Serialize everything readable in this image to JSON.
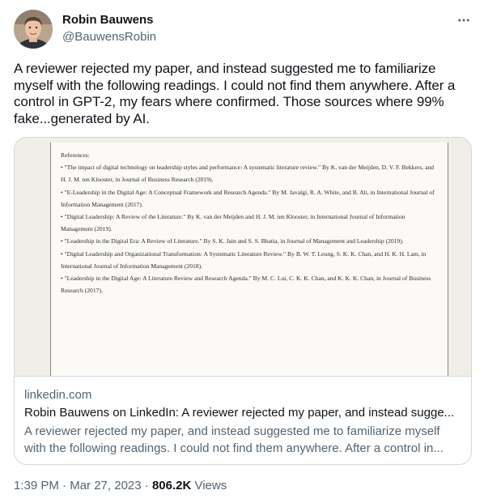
{
  "author": {
    "name": "Robin Bauwens",
    "handle": "@BauwensRobin"
  },
  "tweet": {
    "text": "A reviewer rejected my paper, and instead suggested me to familiarize myself with the following readings. I could not find them anywhere. After a control in GPT-2, my fears where confirmed. Those sources where 99% fake...generated by AI."
  },
  "card": {
    "document": {
      "heading": "References:",
      "references": [
        "•  \"The impact of digital technology on leadership styles and performance: A systematic literature review.\" By K. van der Meijden, D. V. F. Bekkers, and H. J. M. ten Klooster, in Journal of Business Research (2019).",
        "•  \"E-Leadership in the Digital Age: A Conceptual Framework and Research Agenda.\" By M. Javalgi, R. A. White, and B. Ali, in International Journal of Information Management (2017).",
        "•  \"Digital Leadership: A Review of the Literature.\" By K. van der Meijden and H. J. M. ten Klooster, in International Journal of Information Management (2019).",
        "•  \"Leadership in the Digital Era: A Review of Literature.\" By S. K. Jain and S. S. Bhatia, in Journal of Management and Leadership (2019).",
        "•  \"Digital Leadership and Organizational Transformation: A Systematic Literature Review.\" By B. W. T. Leung, S. K. K. Chan, and H. K. H. Lam, in International Journal of Information Management (2018).",
        "•  \"Leadership in the Digital Age: A Literature Review and Research Agenda.\" By M. C. Lui, C. K. K. Chan, and K. K. K. Chan, in Journal of Business Research (2017)."
      ]
    },
    "domain": "linkedin.com",
    "title": "Robin Bauwens on LinkedIn: A reviewer rejected my paper, and instead sugge...",
    "description": "A reviewer rejected my paper, and instead suggested me to familiarize myself with the following readings. I could not find them anywhere. After a control in..."
  },
  "meta": {
    "time": "1:39 PM",
    "separator": " · ",
    "date": "Mar 27, 2023",
    "separator2": " · ",
    "views_count": "806.2K",
    "views_label": " Views"
  },
  "icons": {
    "more": "more-horizontal-icon"
  },
  "colors": {
    "text_primary": "#0f1419",
    "text_secondary": "#536471",
    "border": "#cfd9de"
  }
}
